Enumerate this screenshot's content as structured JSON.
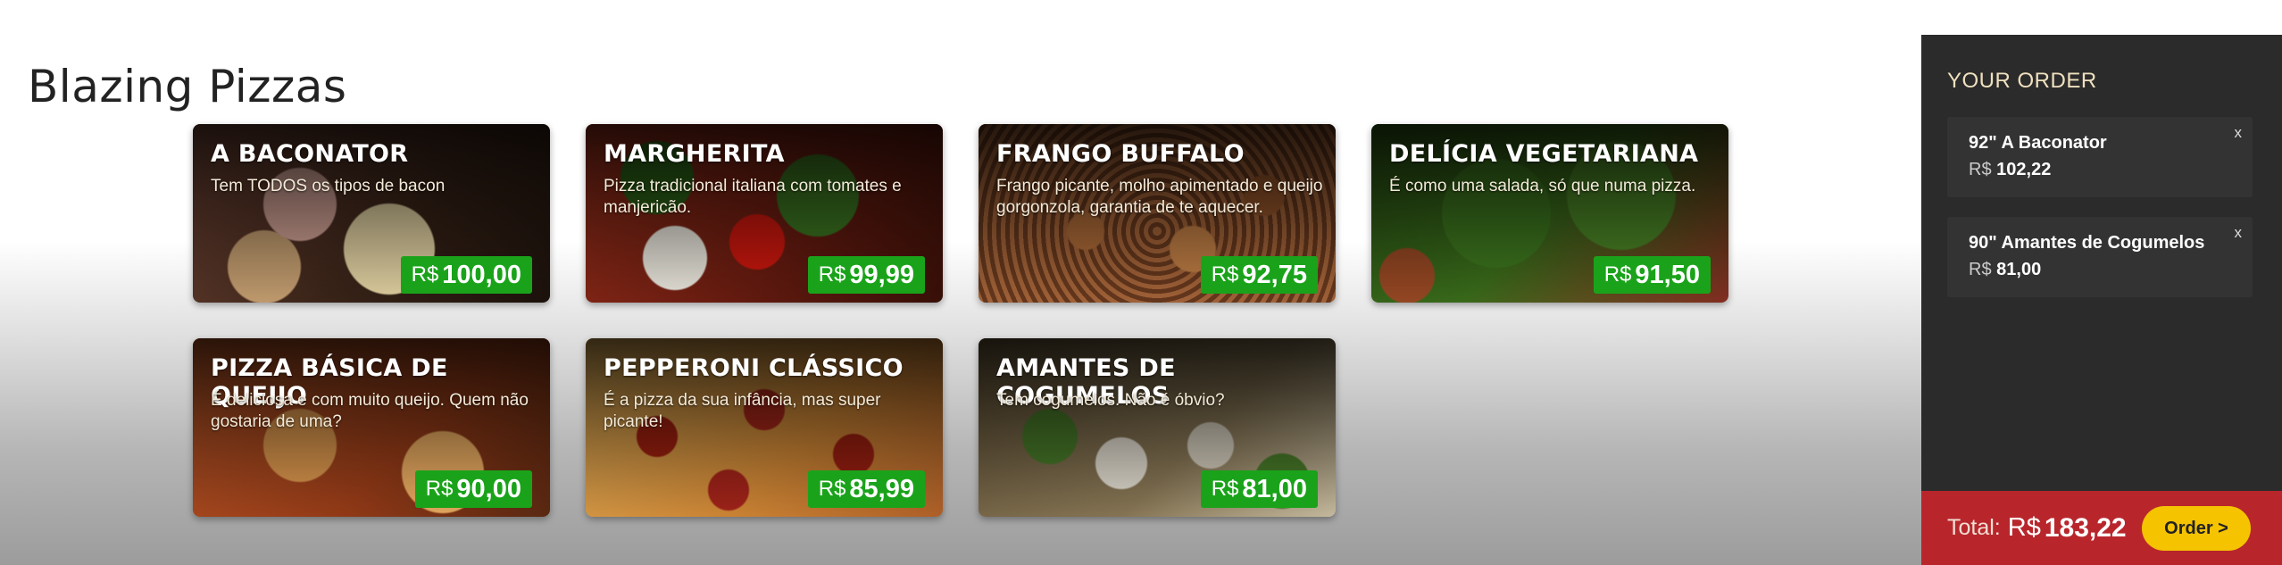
{
  "page": {
    "title": "Blazing Pizzas"
  },
  "pizzas": [
    {
      "name": "A BACONATOR",
      "description": "Tem TODOS os tipos de bacon",
      "currency": "R$",
      "price": "100,00"
    },
    {
      "name": "MARGHERITA",
      "description": "Pizza tradicional italiana com tomates e manjericão.",
      "currency": "R$",
      "price": "99,99"
    },
    {
      "name": "FRANGO BUFFALO",
      "description": "Frango picante, molho apimentado e queijo gorgonzola, garantia de te aquecer.",
      "currency": "R$",
      "price": "92,75"
    },
    {
      "name": "DELÍCIA VEGETARIANA",
      "description": "É como uma salada, só que numa pizza.",
      "currency": "R$",
      "price": "91,50"
    },
    {
      "name": "PIZZA BÁSICA DE QUEIJO",
      "description": "É deliciosa e com muito queijo. Quem não gostaria de uma?",
      "currency": "R$",
      "price": "90,00"
    },
    {
      "name": "PEPPERONI CLÁSSICO",
      "description": "É a pizza da sua infância, mas super picante!",
      "currency": "R$",
      "price": "85,99"
    },
    {
      "name": "AMANTES DE COGUMELOS",
      "description": "Tem cogumelos. Não é óbvio?",
      "currency": "R$",
      "price": "81,00"
    }
  ],
  "order": {
    "heading": "YOUR ORDER",
    "items": [
      {
        "name": "92\" A Baconator",
        "currency": "R$",
        "price": "102,22",
        "remove_label": "x"
      },
      {
        "name": "90\" Amantes de Cogumelos",
        "currency": "R$",
        "price": "81,00",
        "remove_label": "x"
      }
    ],
    "total_label": "Total:",
    "total_currency": "R$",
    "total_value": "183,22",
    "order_button": "Order >"
  },
  "colors": {
    "price_badge": "#1aa31a",
    "sidebar": "#2b2b2b",
    "footer": "#b8262c",
    "order_button": "#f5c300"
  }
}
